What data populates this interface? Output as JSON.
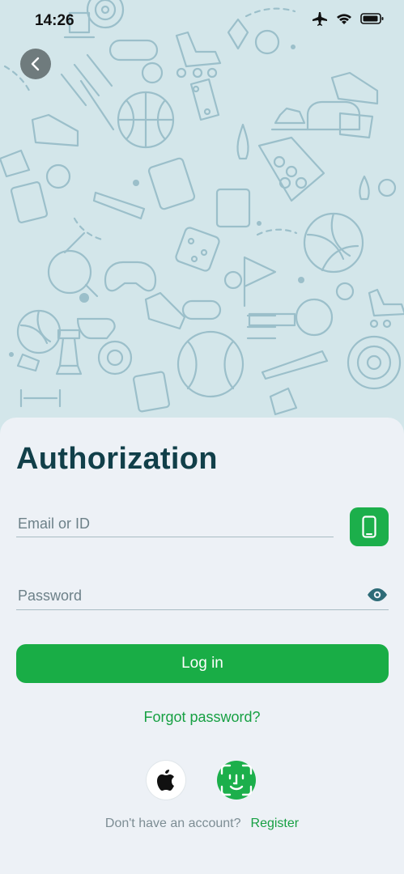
{
  "status_bar": {
    "time": "14:26",
    "icons": [
      "airplane-icon",
      "wifi-icon",
      "battery-icon"
    ]
  },
  "header": {
    "back_icon": "chevron-left-icon"
  },
  "form": {
    "title": "Authorization",
    "email_placeholder": "Email or ID",
    "password_placeholder": "Password",
    "login_label": "Log in",
    "forgot_label": "Forgot password?",
    "no_account_text": "Don't have an account?",
    "register_label": "Register"
  },
  "colors": {
    "accent": "#1caf4b",
    "title": "#113f49",
    "background": "#edf1f6",
    "hero": "#d3e6ea"
  }
}
